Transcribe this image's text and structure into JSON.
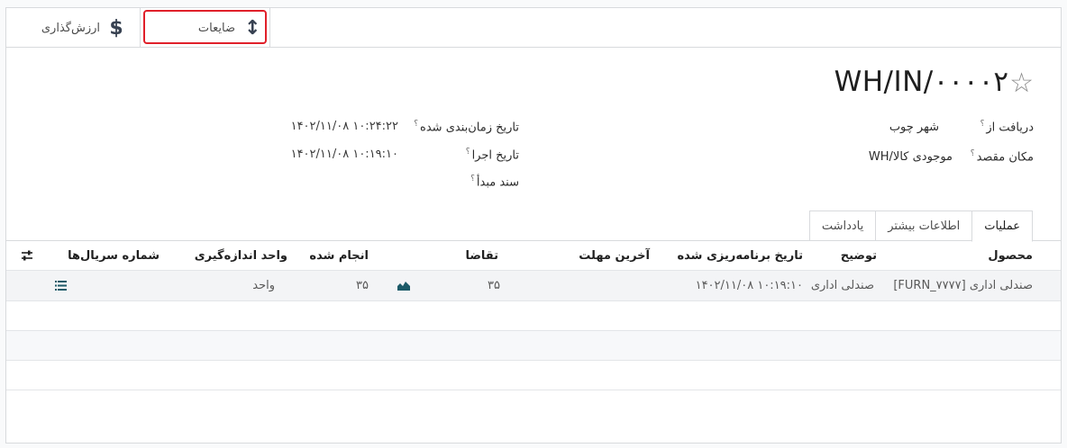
{
  "smart_buttons": {
    "scrap_label": "ضایعات",
    "scrap_icon": "↕",
    "valuation_label": "ارزش‌گذاری",
    "valuation_icon": "$"
  },
  "record": {
    "name": "WH/IN/۰۰۰۰۲",
    "favorite_icon": "☆"
  },
  "fields": {
    "receive_from_label": "دریافت از",
    "receive_from_value": "شهر چوب",
    "destination_label": "مکان مقصد",
    "destination_value": "WH/موجودی کالا",
    "scheduled_label": "تاریخ زمان‌بندی شده",
    "scheduled_value": "۱۴۰۲/۱۱/۰۸ ۱۰:۲۴:۲۲",
    "effective_label": "تاریخ اجرا",
    "effective_value": "۱۴۰۲/۱۱/۰۸ ۱۰:۱۹:۱۰",
    "source_label": "سند مبدأ",
    "help_mark": "؟"
  },
  "tabs": [
    "عملیات",
    "اطلاعات بیشتر",
    "یادداشت"
  ],
  "table": {
    "headers": {
      "product": "محصول",
      "description": "توضیح",
      "scheduled": "تاریخ برنامه‌ریزی شده",
      "deadline": "آخرین مهلت",
      "demand": "تقاضا",
      "done": "انجام شده",
      "uom": "واحد اندازه‌گیری",
      "serials": "شماره سریال‌ها"
    },
    "rows": [
      {
        "product": "[FURN_۷۷۷۷] صندلی اداری",
        "description": "صندلی اداری",
        "scheduled": "۱۴۰۲/۱۱/۰۸ ۱۰:۱۹:۱۰",
        "deadline": "",
        "demand": "۳۵",
        "done": "۳۵",
        "uom": "واحد"
      }
    ],
    "optional_columns_icon": "sliders-icon",
    "forecast_icon": "chart-area-icon",
    "details_icon": "list-icon"
  }
}
